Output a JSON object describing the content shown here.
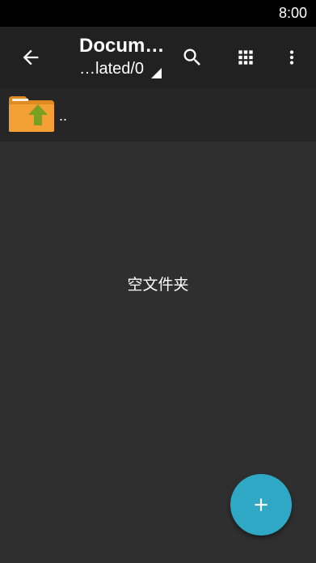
{
  "status_bar": {
    "time": "8:00"
  },
  "app_bar": {
    "title": "Docum…",
    "path": "…lated/0",
    "icons": {
      "back": "arrow-back-icon",
      "search": "search-icon",
      "view_mode": "grid-view-icon",
      "overflow": "more-vert-icon"
    }
  },
  "file_list": {
    "items": [
      {
        "name": "..",
        "icon": "folder-up-icon"
      }
    ],
    "empty_message": "空文件夹"
  },
  "fab": {
    "icon": "add-icon"
  },
  "colors": {
    "status_bar": "#000000",
    "app_bar": "#212121",
    "background": "#2f2f2f",
    "list_row": "#262626",
    "fab": "#2ea8c4",
    "folder": "#f5a034",
    "folder_arrow": "#7aa021"
  }
}
